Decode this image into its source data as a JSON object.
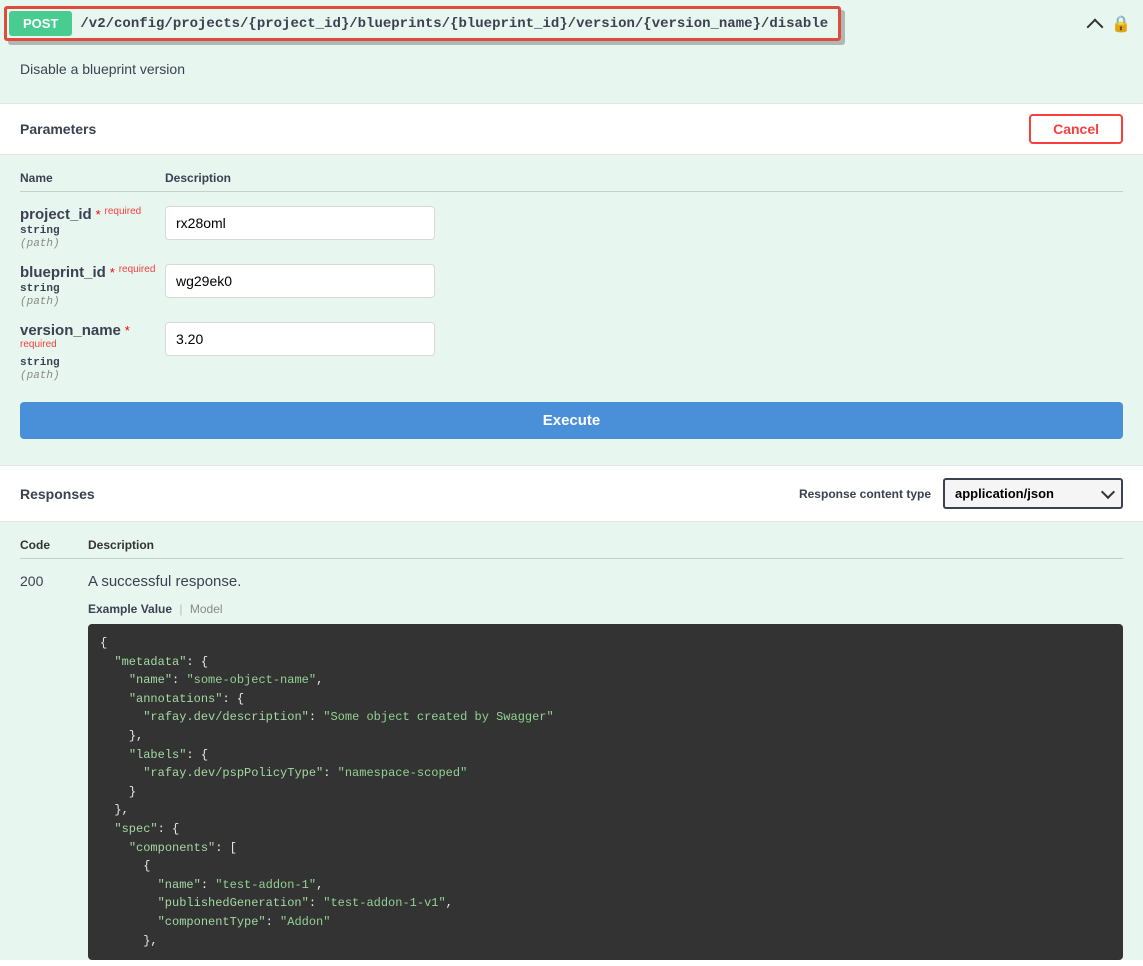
{
  "endpoint": {
    "method": "POST",
    "path": "/v2/config/projects/{project_id}/blueprints/{blueprint_id}/version/{version_name}/disable",
    "summary": "Disable a blueprint version"
  },
  "sections": {
    "parameters_label": "Parameters",
    "responses_label": "Responses",
    "cancel_label": "Cancel",
    "execute_label": "Execute"
  },
  "param_headers": {
    "name": "Name",
    "description": "Description"
  },
  "params": [
    {
      "name": "project_id",
      "required_label": "required",
      "type": "string",
      "in": "(path)",
      "value": "rx28oml"
    },
    {
      "name": "blueprint_id",
      "required_label": "required",
      "type": "string",
      "in": "(path)",
      "value": "wg29ek0"
    },
    {
      "name": "version_name",
      "required_label": "required",
      "type": "string",
      "in": "(path)",
      "value": "3.20"
    }
  ],
  "responses": {
    "content_type_label": "Response content type",
    "content_type_value": "application/json",
    "headers": {
      "code": "Code",
      "description": "Description"
    },
    "items": [
      {
        "code": "200",
        "description": "A successful response.",
        "tabs": {
          "example": "Example Value",
          "model": "Model"
        },
        "example_json": {
          "metadata": {
            "name": "some-object-name",
            "annotations": {
              "rafay.dev/description": "Some object created by Swagger"
            },
            "labels": {
              "rafay.dev/pspPolicyType": "namespace-scoped"
            }
          },
          "spec": {
            "components": [
              {
                "name": "test-addon-1",
                "publishedGeneration": "test-addon-1-v1",
                "componentType": "Addon"
              }
            ]
          }
        }
      }
    ]
  }
}
